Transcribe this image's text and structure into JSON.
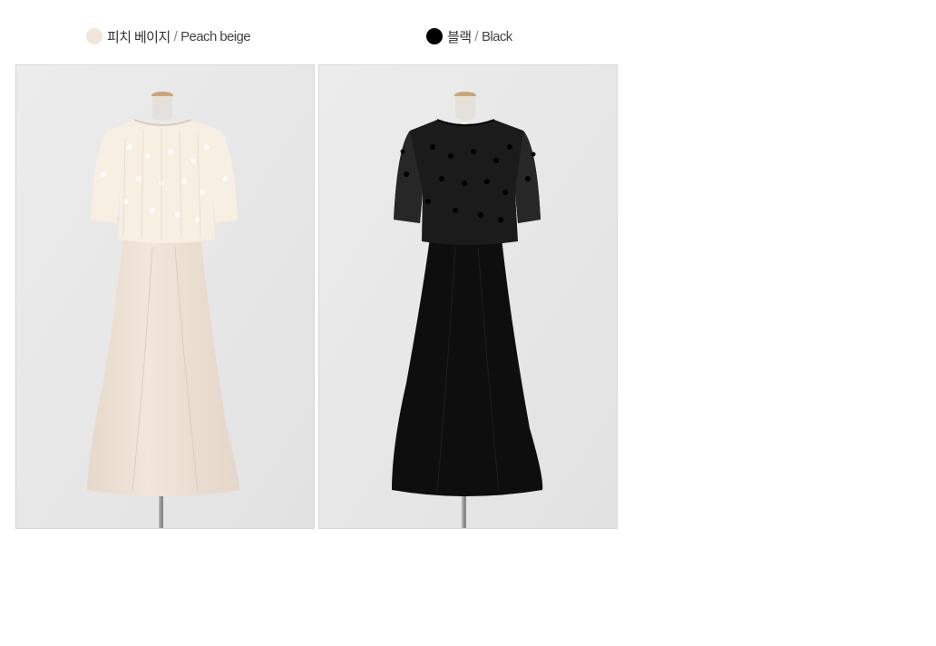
{
  "colors": {
    "peach": {
      "swatch_hex": "#f1e6da",
      "label_ko": "피치 베이지",
      "separator": "/",
      "label_en": "Peach beige",
      "image_alt": "피치 베이지 / Peach beige",
      "top_hex": "#f6efe2",
      "skirt_hex": "#efe3d6"
    },
    "black": {
      "swatch_hex": "#000000",
      "label_ko": "블랙",
      "separator": "/",
      "label_en": "Black",
      "image_alt": "블랙 / Black",
      "top_hex": "#1a1a1a",
      "skirt_hex": "#0d0d0d"
    }
  }
}
